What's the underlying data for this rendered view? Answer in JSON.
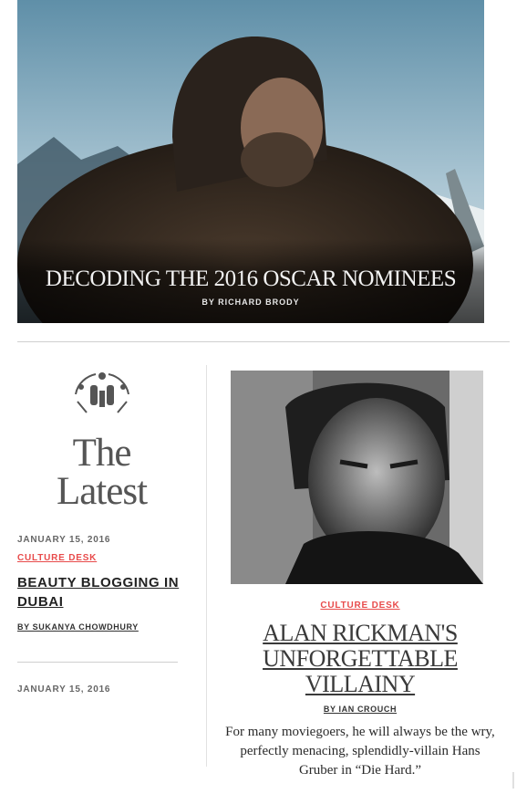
{
  "hero": {
    "title": "Decoding the 2016 Oscar Nominees",
    "byline": "By Richard Brody",
    "image_icon": "photo-icon"
  },
  "latest": {
    "heading_line1": "The",
    "heading_line2": "Latest",
    "items": [
      {
        "date": "January 15, 2016",
        "category": "Culture Desk",
        "title": "Beauty Blogging in Dubai",
        "byline": "By Sukanya Chowdhury"
      },
      {
        "date": "January 15, 2016"
      }
    ]
  },
  "feature": {
    "category": "Culture Desk",
    "title_line1": "Alan Rickman's",
    "title_line2": "Unforgettable",
    "title_line3": "Villainy",
    "byline": "By Ian Crouch",
    "excerpt": "For many moviegoers, he will always be the wry, perfectly menacing, splendidly-villain Hans Gruber in “Die Hard.”"
  },
  "colors": {
    "accent_red": "#e84b4b",
    "text_dark": "#1a1a1a",
    "rule": "#cfcfcf"
  }
}
